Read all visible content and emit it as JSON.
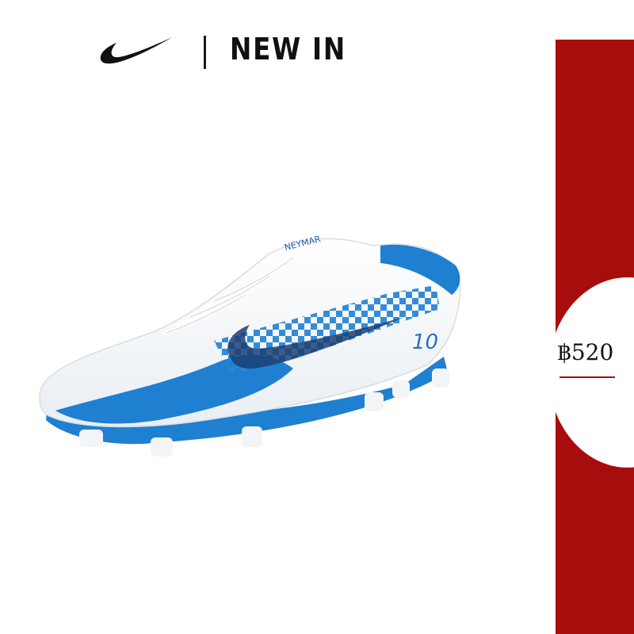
{
  "brand": {
    "logo_icon": "swoosh-logo-icon"
  },
  "header": {
    "title": "NEW IN"
  },
  "price": {
    "label": "฿520"
  },
  "product": {
    "icon": "football-boot-image",
    "side_text": "NEYMAR",
    "number": "10"
  },
  "colors": {
    "band": "#a80d0d",
    "accent_blue": "#1f7fd1",
    "logo": "#111111",
    "background": "#ffffff"
  }
}
